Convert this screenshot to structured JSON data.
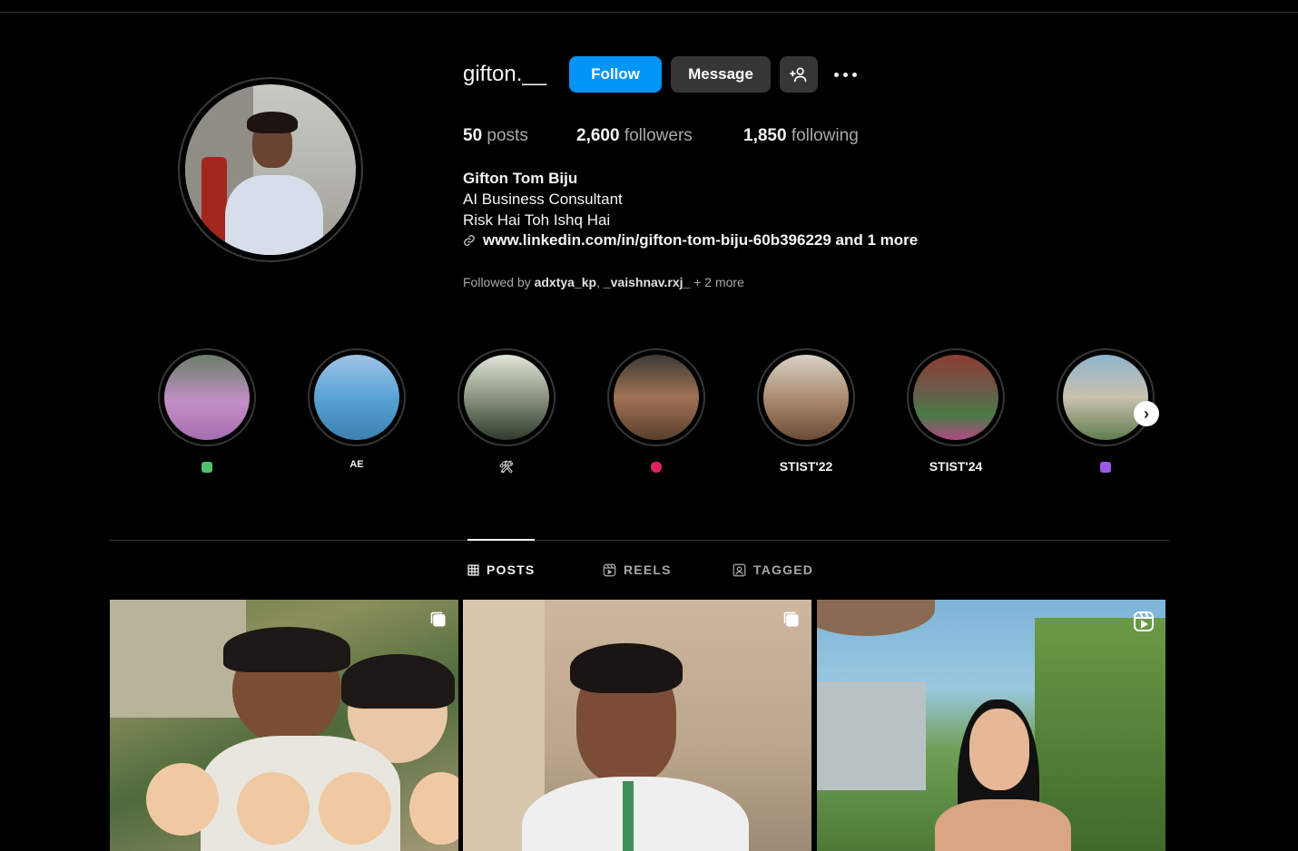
{
  "profile": {
    "username": "gifton.__",
    "follow_label": "Follow",
    "message_label": "Message",
    "posts_count": "50",
    "posts_label": "posts",
    "followers_count": "2,600",
    "followers_label": "followers",
    "following_count": "1,850",
    "following_label": "following",
    "full_name": "Gifton Tom Biju",
    "bio_line1": "AI Business Consultant",
    "bio_line2": "Risk Hai Toh Ishq Hai",
    "link": "www.linkedin.com/in/gifton-tom-biju-60b396229 and 1 more",
    "followed_by_prefix": "Followed by",
    "followed_by_user1": "adxtya_kp",
    "followed_by_user2": "_vaishnav.rxj_",
    "followed_by_more": "+ 2 more"
  },
  "highlights": [
    {
      "label": "",
      "emoji_color": "#4fc36a"
    },
    {
      "label": "AE"
    },
    {
      "label": "",
      "emoji_color": "#c0c0c0"
    },
    {
      "label": "",
      "emoji_color": "#e0245e"
    },
    {
      "label": "STIST'22"
    },
    {
      "label": "STIST'24"
    },
    {
      "label": "",
      "emoji_color": "#9b59e6"
    }
  ],
  "tabs": {
    "posts": "POSTS",
    "reels": "REELS",
    "tagged": "TAGGED"
  },
  "colors": {
    "accent": "#0095f6",
    "button_secondary": "#363636",
    "background": "#000000"
  }
}
